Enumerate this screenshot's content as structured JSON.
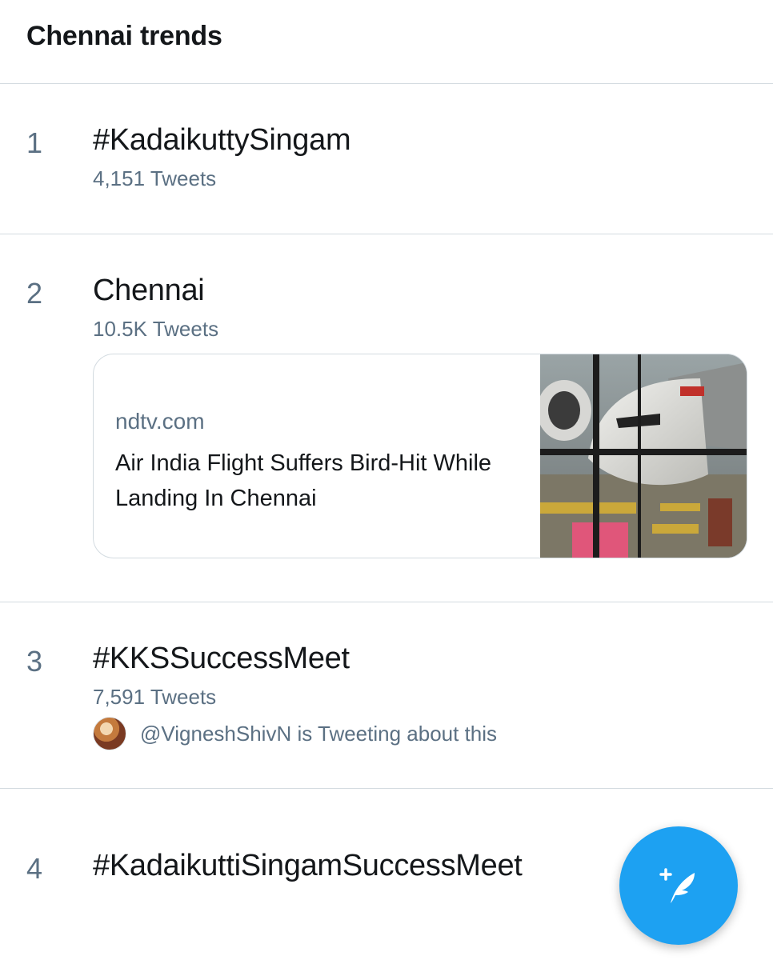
{
  "header": {
    "title": "Chennai trends"
  },
  "trends": [
    {
      "rank": "1",
      "name": "#KadaikuttySingam",
      "count": "4,151 Tweets"
    },
    {
      "rank": "2",
      "name": "Chennai",
      "count": "10.5K Tweets",
      "news": {
        "source": "ndtv.com",
        "headline": "Air India Flight Suffers Bird-Hit While Landing In Chennai"
      }
    },
    {
      "rank": "3",
      "name": "#KKSSuccessMeet",
      "count": "7,591 Tweets",
      "mention": "@VigneshShivN is Tweeting about this"
    },
    {
      "rank": "4",
      "name": "#KadaikuttiSingamSuccessMeet"
    }
  ],
  "fab": {
    "icon": "compose-tweet-icon"
  },
  "colors": {
    "accent": "#1da1f2",
    "secondary_text": "#5b7083",
    "primary_text": "#14171a",
    "divider": "#d3dbe0"
  }
}
